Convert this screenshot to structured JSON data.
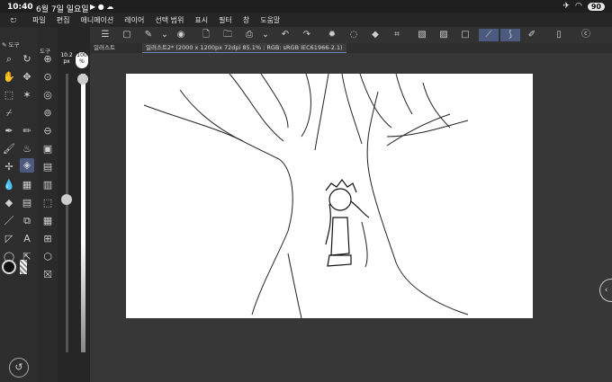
{
  "status_bar": {
    "time": "10:40",
    "date": "6월 7일 일요일",
    "battery": "90"
  },
  "menu": {
    "items": [
      "파일",
      "편집",
      "애니메이션",
      "레이어",
      "선택 범위",
      "표시",
      "필터",
      "창",
      "도움말"
    ]
  },
  "tabs": {
    "first": "일러스트",
    "active": "일러스트2* (2000 x 1200px 72dpi 85.1% : RGB: sRGB IEC61966-2.1)"
  },
  "left_panel": {
    "tool_label": "도구",
    "sub_label": "도구"
  },
  "brush": {
    "size_value": "10.2",
    "size_unit": "px",
    "opacity_value": "100",
    "opacity_unit": "%",
    "size_level": 0.55,
    "opacity_level": 1.0
  },
  "colors": {
    "accent": "#4d5a80",
    "background": "#2b2b2b",
    "canvas": "#ffffff",
    "tab_highlight": "#6a7fb5"
  }
}
